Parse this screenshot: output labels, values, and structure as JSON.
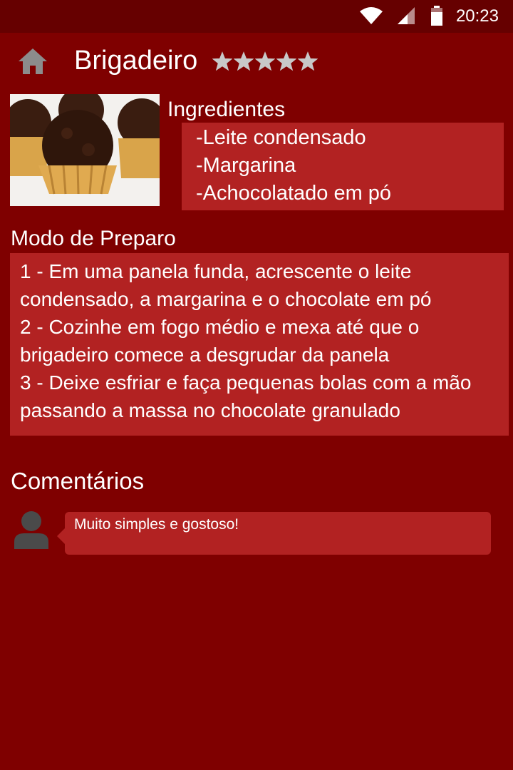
{
  "status_bar": {
    "time": "20:23",
    "icons": [
      "wifi-icon",
      "signal-icon",
      "battery-icon"
    ]
  },
  "header": {
    "home_icon": "home-icon",
    "title": "Brigadeiro",
    "rating": 5,
    "rating_max": 5
  },
  "image": {
    "subject": "brigadeiros in paper cups"
  },
  "ingredients": {
    "title": "Ingredientes",
    "items": [
      "-Leite condensado",
      "-Margarina",
      "-Achocolatado em pó"
    ]
  },
  "preparation": {
    "title": "Modo de Preparo",
    "steps": [
      "1 - Em uma panela funda, acrescente o leite condensado, a margarina e o chocolate em pó",
      "2 - Cozinhe em fogo médio e mexa até que o brigadeiro comece a desgrudar da panela",
      "3 - Deixe esfriar e faça pequenas bolas com a mão passando a massa no chocolate granulado"
    ]
  },
  "comments": {
    "title": "Comentários",
    "items": [
      {
        "avatar_icon": "user-avatar-icon",
        "text": "Muito simples e gostoso!"
      }
    ]
  },
  "colors": {
    "background": "#7f0000",
    "status_bar": "#660000",
    "panel": "#b22222",
    "star": "#c8c8c8",
    "home_icon": "#8c8c8c",
    "avatar": "#4a4a4a"
  }
}
